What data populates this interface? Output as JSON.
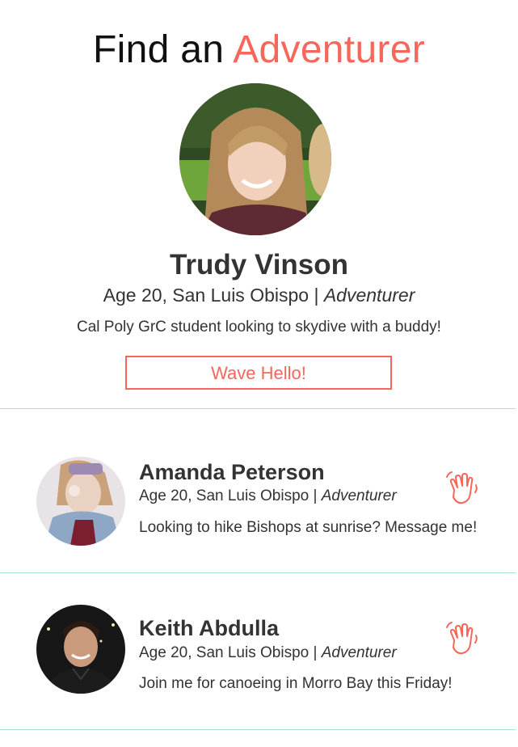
{
  "header": {
    "title_prefix": "Find an",
    "title_accent": "Adventurer"
  },
  "featured": {
    "name": "Trudy Vinson",
    "meta": "Age 20, San Luis Obispo | ",
    "role": "Adventurer",
    "bio": "Cal Poly GrC student looking to skydive with a buddy!",
    "button_label": "Wave Hello!",
    "avatar_icon": "profile-photo"
  },
  "list": [
    {
      "name": "Amanda Peterson",
      "meta": "Age 20, San Luis Obispo | ",
      "role": "Adventurer",
      "bio": "Looking to hike Bishops at sunrise? Message me!",
      "action_icon": "wave-hand-icon"
    },
    {
      "name": "Keith Abdulla",
      "meta": "Age 20, San Luis Obispo | ",
      "role": "Adventurer",
      "bio": "Join me for canoeing in Morro Bay this Friday!",
      "action_icon": "wave-hand-icon"
    }
  ],
  "colors": {
    "accent": "#f4675a",
    "divider": "#a8e3d2",
    "text": "#333333"
  }
}
